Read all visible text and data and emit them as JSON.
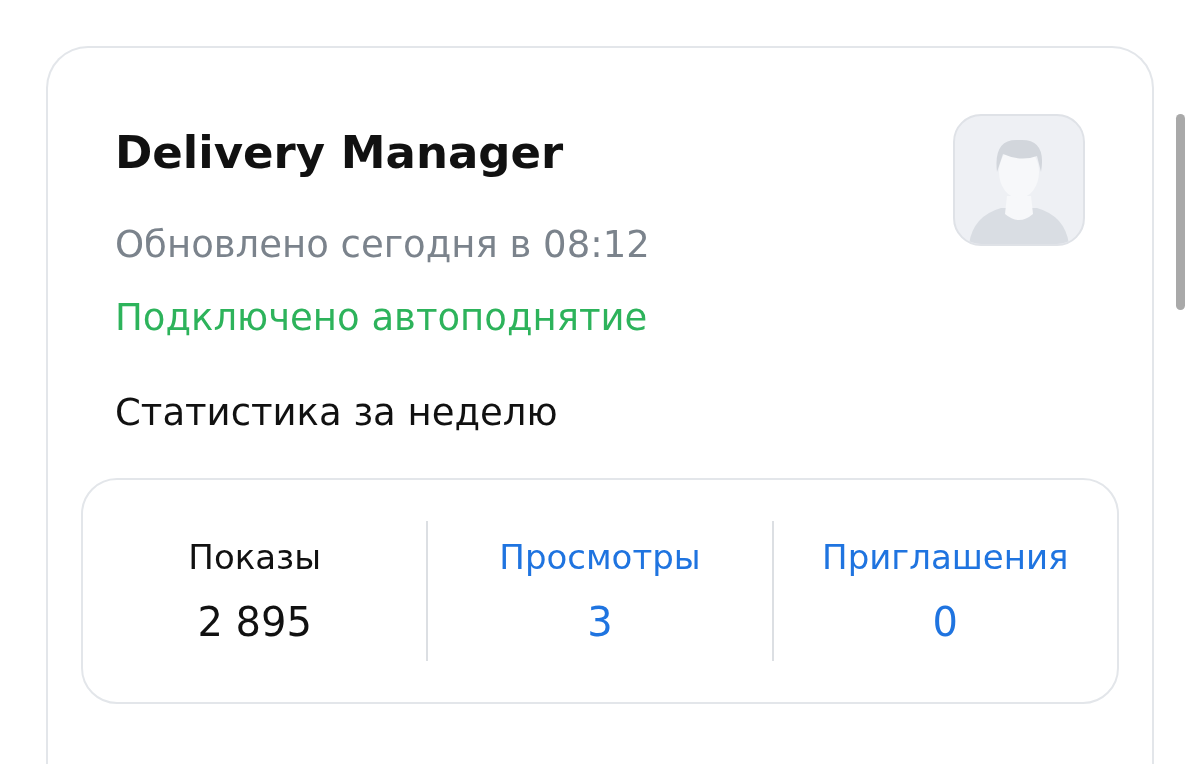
{
  "vacancy": {
    "title": "Delivery Manager",
    "updated": "Обновлено сегодня в 08:12",
    "autoraise": "Подключено автоподнятие",
    "stats_heading": "Статистика за неделю",
    "stats": [
      {
        "kind": "plain",
        "label": "Показы",
        "value": "2 895"
      },
      {
        "kind": "link",
        "label": "Просмотры",
        "value": "3"
      },
      {
        "kind": "link",
        "label": "Приглашения",
        "value": "0"
      }
    ]
  }
}
